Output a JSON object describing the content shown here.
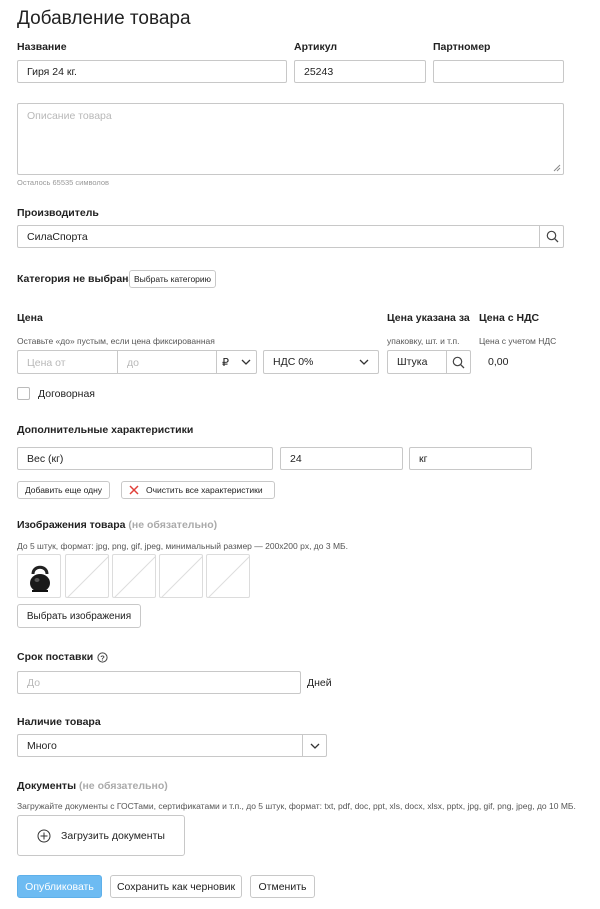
{
  "page": {
    "title": "Добавление товара"
  },
  "name": {
    "label": "Название",
    "value": "Гиря 24 кг."
  },
  "sku": {
    "label": "Артикул",
    "value": "25243"
  },
  "partnumber": {
    "label": "Партномер",
    "value": ""
  },
  "description": {
    "placeholder": "Описание товара",
    "remaining": "Осталось 65535 символов"
  },
  "manufacturer": {
    "label": "Производитель",
    "value": "СилаСпорта"
  },
  "category": {
    "label": "Категория не выбрана",
    "button": "Выбрать категорию"
  },
  "price": {
    "label": "Цена",
    "hint": "Оставьте «до» пустым, если цена фиксированная",
    "from_placeholder": "Цена от",
    "to_placeholder": "до",
    "currency": "₽",
    "vat": "НДС 0%",
    "unit_label": "Цена указана за",
    "unit_hint": "упаковку, шт. и т.п.",
    "unit_value": "Штука",
    "vat_label": "Цена с НДС",
    "vat_hint": "Цена с учетом НДС",
    "vat_value": "0,00",
    "negotiable": "Договорная"
  },
  "characteristics": {
    "label": "Дополнительные характеристики",
    "name": "Вес (кг)",
    "value": "24",
    "unit": "кг",
    "add_button": "Добавить еще одну",
    "clear_button": "Очистить все характеристики"
  },
  "images": {
    "label": "Изображения товара",
    "optional": "(не обязательно)",
    "hint": "До 5 штук, формат: jpg, png, gif, jpeg, минимальный размер — 200х200 px, до 3 МБ.",
    "button": "Выбрать изображения"
  },
  "delivery": {
    "label": "Срок поставки",
    "placeholder": "До",
    "unit": "Дней"
  },
  "availability": {
    "label": "Наличие товара",
    "value": "Много"
  },
  "documents": {
    "label": "Документы",
    "optional": "(не обязательно)",
    "hint": "Загружайте документы с ГОСТами, сертификатами и т.п., до 5 штук, формат: txt, pdf, doc, ppt, xls, docx, xlsx, pptx, jpg, gif, png, jpeg, до 10 МБ.",
    "upload": "Загрузить документы"
  },
  "actions": {
    "publish": "Опубликовать",
    "draft": "Сохранить как черновик",
    "cancel": "Отменить"
  },
  "colors": {
    "primary": "#6dbbf2",
    "clear_x": "#e0403a"
  }
}
